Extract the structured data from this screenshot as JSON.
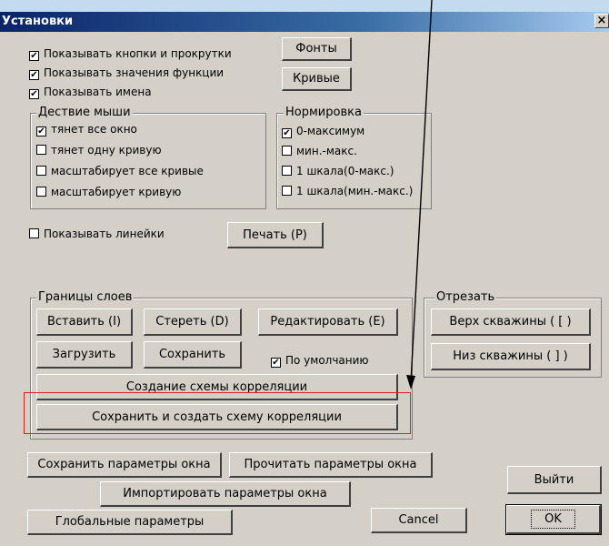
{
  "window": {
    "title": "Установки",
    "close_glyph": "×"
  },
  "checkbox_glyph": "✔",
  "top_checks": [
    {
      "label": "Показывать кнопки и прокрутки",
      "checked": true
    },
    {
      "label": "Показывать значения функции",
      "checked": true
    },
    {
      "label": "Показывать имена",
      "checked": true
    }
  ],
  "top_buttons": {
    "fonts": "Фонты",
    "curves": "Кривые"
  },
  "mouse_group": {
    "title": "Дествие мыши",
    "items": [
      {
        "label": "тянет все окно",
        "checked": true
      },
      {
        "label": "тянет одну кривую",
        "checked": false
      },
      {
        "label": "масштабирует все кривые",
        "checked": false
      },
      {
        "label": "масштабирует кривую",
        "checked": false
      }
    ]
  },
  "norm_group": {
    "title": "Нормировка",
    "items": [
      {
        "label": "0-максимум",
        "checked": true
      },
      {
        "label": "мин.-макс.",
        "checked": false
      },
      {
        "label": "1 шкала(0-макс.)",
        "checked": false
      },
      {
        "label": "1 шкала(мин.-макс.)",
        "checked": false
      }
    ]
  },
  "rulers": {
    "label": "Показывать линейки",
    "checked": false
  },
  "print_button": "Печать (P)",
  "layers_group": {
    "title": "Границы слоев",
    "insert": "Вставить (I)",
    "erase": "Стереть (D)",
    "edit": "Редактировать (E)",
    "load": "Загрузить",
    "save": "Сохранить",
    "default_check": {
      "label": "По умолчанию",
      "checked": true
    },
    "create_scheme": "Создание схемы корреляции",
    "save_create_scheme": "Сохранить и создать схему корреляции"
  },
  "cut_group": {
    "title": "Отрезать",
    "top": "Верх скважины ( [ )",
    "bottom": "Низ скважины ( ] )"
  },
  "bottom_buttons": {
    "save_params": "Сохранить параметры окна",
    "read_params": "Прочитать параметры окна",
    "import_params": "Импортировать параметры окна",
    "global_params": "Глобальные параметры",
    "cancel": "Cancel",
    "exit": "Выйти",
    "ok": "OK"
  },
  "colors": {
    "highlight_box": "#e0201c",
    "titlebar": "#0a246a",
    "dialog_bg": "#d4d0c8"
  }
}
